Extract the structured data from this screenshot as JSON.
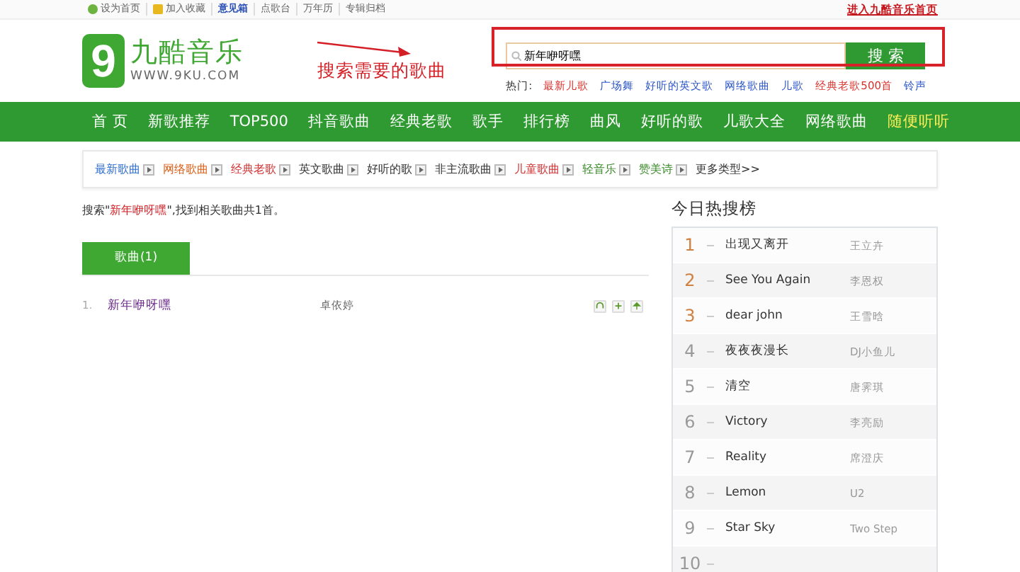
{
  "top_links": [
    {
      "label": "设为首页",
      "kind": "home",
      "bold": false
    },
    {
      "label": "加入收藏",
      "kind": "fav",
      "bold": false
    },
    {
      "label": "意见箱",
      "kind": "plain",
      "bold": true
    },
    {
      "label": "点歌台",
      "kind": "plain",
      "bold": false
    },
    {
      "label": "万年历",
      "kind": "plain",
      "bold": false
    },
    {
      "label": "专辑归档",
      "kind": "plain",
      "bold": false
    }
  ],
  "home_link": "进入九酷音乐首页",
  "logo": {
    "digit": "9",
    "name": "九酷音乐",
    "url": "WWW.9KU.COM"
  },
  "annotation": "搜索需要的歌曲",
  "search": {
    "value": "新年咿呀嘿",
    "button": "搜 索"
  },
  "hot_label": "热门:",
  "hot_words": [
    {
      "label": "最新儿歌",
      "color": "#d9302a"
    },
    {
      "label": "广场舞",
      "color": "#2a55c8"
    },
    {
      "label": "好听的英文歌",
      "color": "#2a55c8"
    },
    {
      "label": "网络歌曲",
      "color": "#2a55c8"
    },
    {
      "label": "儿歌",
      "color": "#2a55c8"
    },
    {
      "label": "经典老歌500首",
      "color": "#d9302a"
    },
    {
      "label": "铃声",
      "color": "#2a55c8"
    }
  ],
  "nav": [
    {
      "label": "首 页",
      "highlighted": false
    },
    {
      "label": "新歌推荐",
      "highlighted": false
    },
    {
      "label": "TOP500",
      "highlighted": false
    },
    {
      "label": "抖音歌曲",
      "highlighted": false
    },
    {
      "label": "经典老歌",
      "highlighted": false
    },
    {
      "label": "歌手",
      "highlighted": false
    },
    {
      "label": "排行榜",
      "highlighted": false
    },
    {
      "label": "曲风",
      "highlighted": false
    },
    {
      "label": "好听的歌",
      "highlighted": false
    },
    {
      "label": "儿歌大全",
      "highlighted": false
    },
    {
      "label": "网络歌曲",
      "highlighted": false
    },
    {
      "label": "随便听听",
      "highlighted": true
    }
  ],
  "categories": [
    {
      "label": "最新歌曲",
      "color": "#2f6fcf",
      "kind": "arrow"
    },
    {
      "label": "网络歌曲",
      "color": "#e0601a",
      "kind": "arrow"
    },
    {
      "label": "经典老歌",
      "color": "#d03030",
      "kind": "arrow"
    },
    {
      "label": "英文歌曲",
      "color": "#333333",
      "kind": "arrow"
    },
    {
      "label": "好听的歌",
      "color": "#333333",
      "kind": "arrow"
    },
    {
      "label": "非主流歌曲",
      "color": "#333333",
      "kind": "arrow"
    },
    {
      "label": "儿童歌曲",
      "color": "#d03030",
      "kind": "arrow"
    },
    {
      "label": "轻音乐",
      "color": "#3a8a2a",
      "kind": "arrow"
    },
    {
      "label": "赞美诗",
      "color": "#3a8a2a",
      "kind": "arrow"
    },
    {
      "label": "更多类型>>",
      "color": "#333333",
      "kind": "more"
    }
  ],
  "result": {
    "prefix": "搜索\"",
    "query": "新年咿呀嘿",
    "suffix": "\",找到相关歌曲共1首。"
  },
  "tabs": [
    {
      "label": "歌曲(1)",
      "selected": true
    }
  ],
  "songs": [
    {
      "index": "1.",
      "title": "新年咿呀嘿",
      "artist": "卓依婷"
    }
  ],
  "hot_list": {
    "title": "今日热搜榜",
    "rows": [
      {
        "rank": "1",
        "title": "出现又离开",
        "artist": "王立卉"
      },
      {
        "rank": "2",
        "title": "See You Again",
        "artist": "李恩权"
      },
      {
        "rank": "3",
        "title": "dear john",
        "artist": "王雪晗"
      },
      {
        "rank": "4",
        "title": "夜夜夜漫长",
        "artist": "DJ小鱼儿"
      },
      {
        "rank": "5",
        "title": "清空",
        "artist": "唐霁琪"
      },
      {
        "rank": "6",
        "title": "Victory",
        "artist": "李亮励"
      },
      {
        "rank": "7",
        "title": "Reality",
        "artist": "席澄庆"
      },
      {
        "rank": "8",
        "title": "Lemon",
        "artist": "U2"
      },
      {
        "rank": "9",
        "title": "Star Sky",
        "artist": "Two Step"
      },
      {
        "rank": "10"
      }
    ]
  }
}
